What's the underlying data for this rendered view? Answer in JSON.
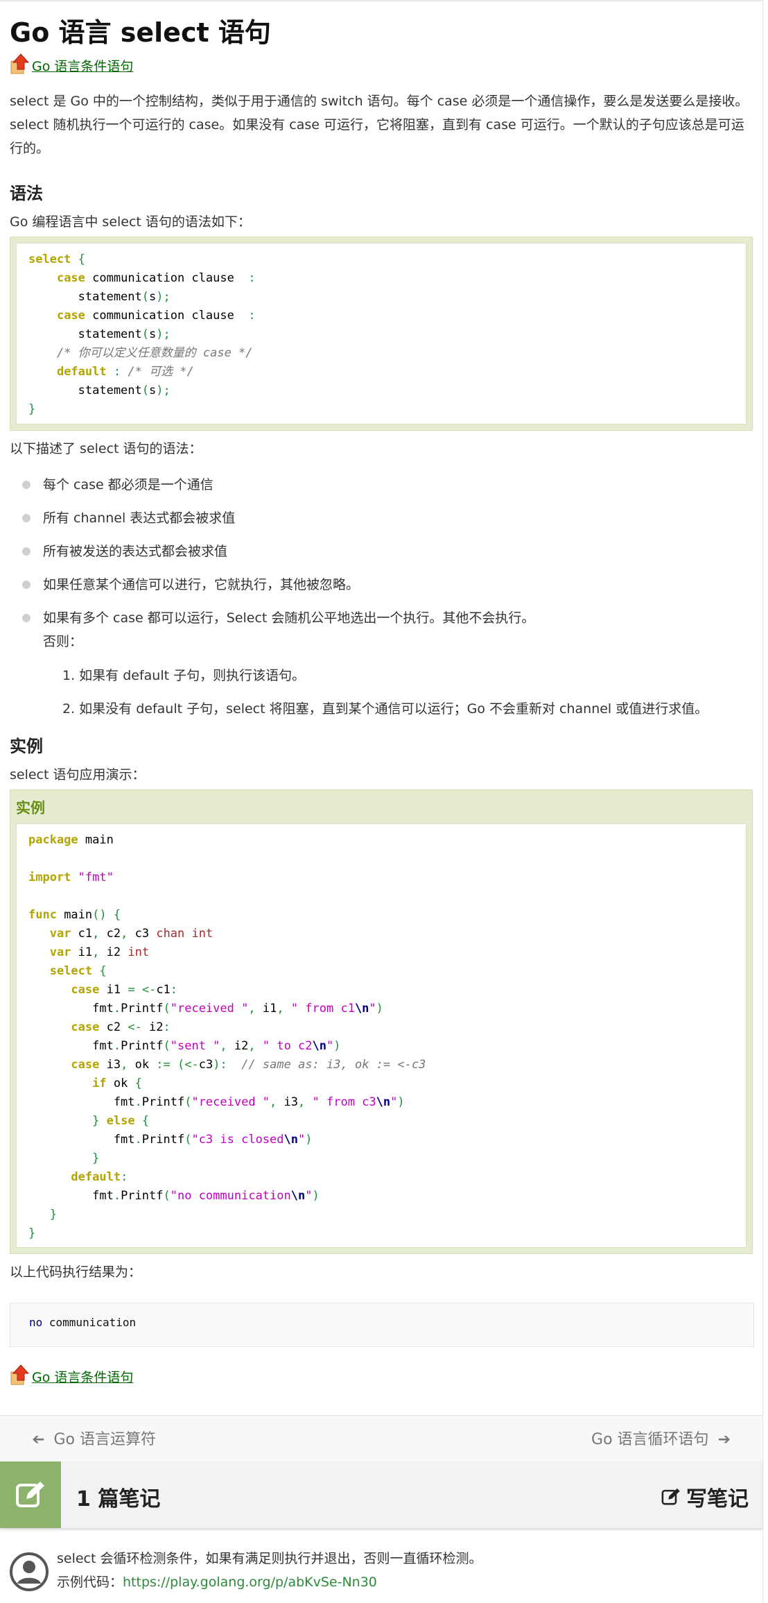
{
  "page": {
    "title": "Go 语言 select 语句",
    "nav_link_top": "Go 语言条件语句",
    "nav_link_bottom": "Go 语言条件语句",
    "intro_lines": [
      "select 是 Go 中的一个控制结构，类似于用于通信的 switch 语句。每个 case 必须是一个通信操作，要么是发送要么是接收。",
      "select 随机执行一个可运行的 case。如果没有 case 可运行，它将阻塞，直到有 case 可运行。一个默认的子句应该总是可运",
      "行的。"
    ],
    "syntax_heading": "语法",
    "syntax_intro": "Go 编程语言中 select 语句的语法如下：",
    "syntax_desc": "以下描述了 select 语句的语法：",
    "bullets": [
      "每个 case 都必须是一个通信",
      "所有 channel 表达式都会被求值",
      "所有被发送的表达式都会被求值",
      "如果任意某个通信可以进行，它就执行，其他被忽略。",
      "如果有多个 case 都可以运行，Select 会随机公平地选出一个执行。其他不会执行。"
    ],
    "otherwise": "否则：",
    "ordered": [
      "如果有 default 子句，则执行该语句。",
      "如果没有 default 子句，select 将阻塞，直到某个通信可以运行；Go 不会重新对 channel 或值进行求值。"
    ],
    "example_heading": "实例",
    "example_intro": "select 语句应用演示：",
    "example_label": "实例",
    "result_intro": "以上代码执行结果为：",
    "output": {
      "keyword": "no",
      "rest": " communication"
    }
  },
  "pager": {
    "prev_label": "Go 语言运算符",
    "next_label": "Go 语言循环语句"
  },
  "notes": {
    "count_label": "1 篇笔记",
    "write_label": "写笔记"
  },
  "comment": {
    "line1": "select 会循环检测条件，如果有满足则执行并退出，否则一直循环检测。",
    "example_prefix": "示例代码：",
    "example_link": "https://play.golang.org/p/abKvSe-Nn30"
  },
  "colors": {
    "accent_green": "#8cb36b",
    "link_green": "#006600",
    "code_keyword": "#b3a400",
    "code_string": "#c000c0",
    "code_box": "#e5eccf"
  },
  "icons": [
    "arrow-up-icon",
    "arrow-left-icon",
    "arrow-right-icon",
    "edit-icon",
    "user-avatar-icon"
  ]
}
